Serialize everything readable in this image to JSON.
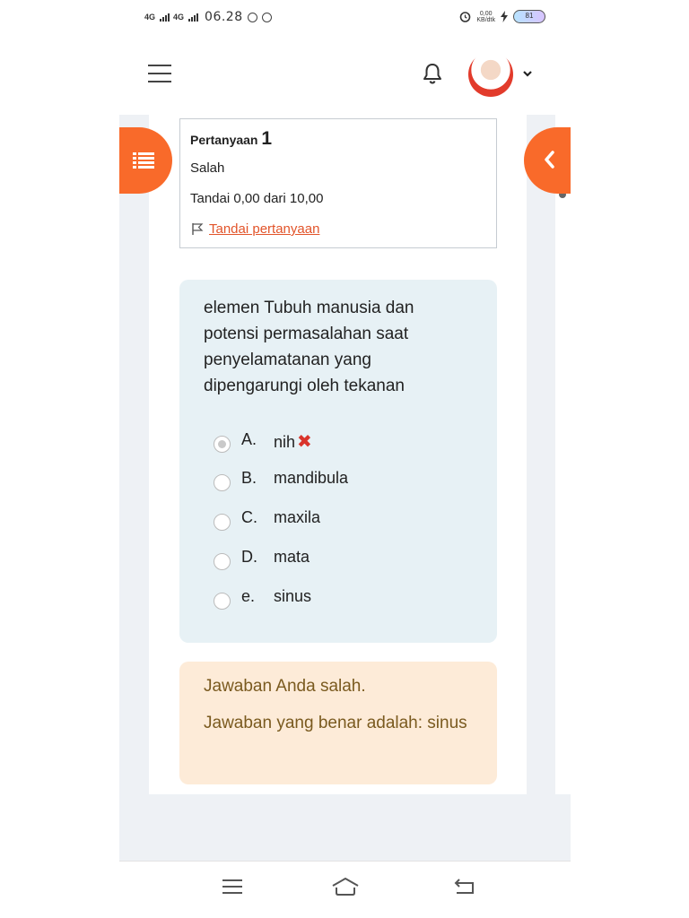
{
  "status_bar": {
    "signal1": "4G",
    "signal2": "4G",
    "time": "06.28",
    "net_speed_value": "0,00",
    "net_speed_unit": "KB/dtk",
    "battery": "81"
  },
  "header": {
    "menu_icon": "hamburger-icon",
    "notification_icon": "bell-icon",
    "user_menu_icon": "chevron-down-icon"
  },
  "question_info": {
    "label": "Pertanyaan",
    "number": "1",
    "state": "Salah",
    "grade": "Tandai 0,00 dari 10,00",
    "flag_link": "Tandai pertanyaan"
  },
  "question": {
    "text": "elemen Tubuh manusia dan potensi permasalahan saat penyelamatanan yang dipengarungi oleh tekanan",
    "options": [
      {
        "letter": "A.",
        "label": "nih",
        "selected": true,
        "incorrect": true
      },
      {
        "letter": "B.",
        "label": "mandibula",
        "selected": false
      },
      {
        "letter": "C.",
        "label": "maxila",
        "selected": false
      },
      {
        "letter": "D.",
        "label": "mata",
        "selected": false
      },
      {
        "letter": "e.",
        "label": "sinus",
        "selected": false
      }
    ]
  },
  "feedback": {
    "result": "Jawaban Anda salah.",
    "correct_answer": "Jawaban yang benar adalah: sinus"
  },
  "colors": {
    "accent": "#f96a2a",
    "link": "#e2542a",
    "question_bg": "#e7f1f5",
    "feedback_bg": "#fdebd8",
    "feedback_text": "#7a5a1f",
    "incorrect": "#d9342b"
  }
}
